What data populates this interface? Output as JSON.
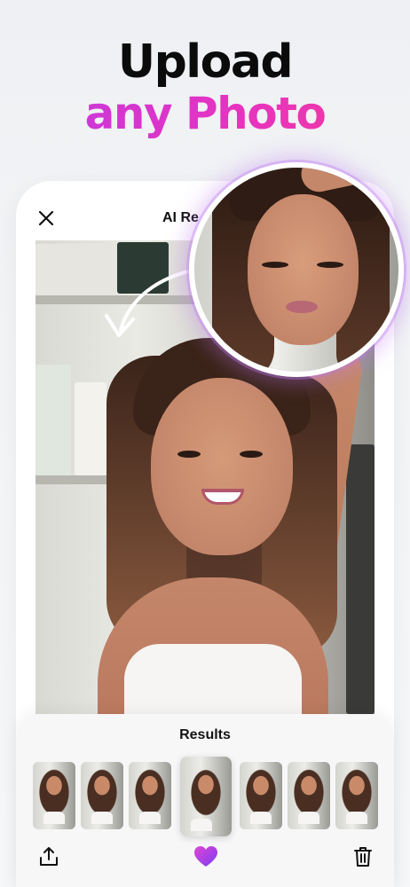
{
  "headline": {
    "line1": "Upload",
    "line2": "any Photo"
  },
  "header": {
    "title": "AI Re"
  },
  "results": {
    "title": "Results",
    "thumbnails": 7,
    "selected_index": 3
  },
  "toolbar": {
    "icons": [
      "share-icon",
      "heart-icon",
      "trash-icon"
    ]
  },
  "colors": {
    "accent_gradient_start": "#c13ae0",
    "accent_gradient_end": "#f23a9b",
    "heart": "#c53be3"
  }
}
